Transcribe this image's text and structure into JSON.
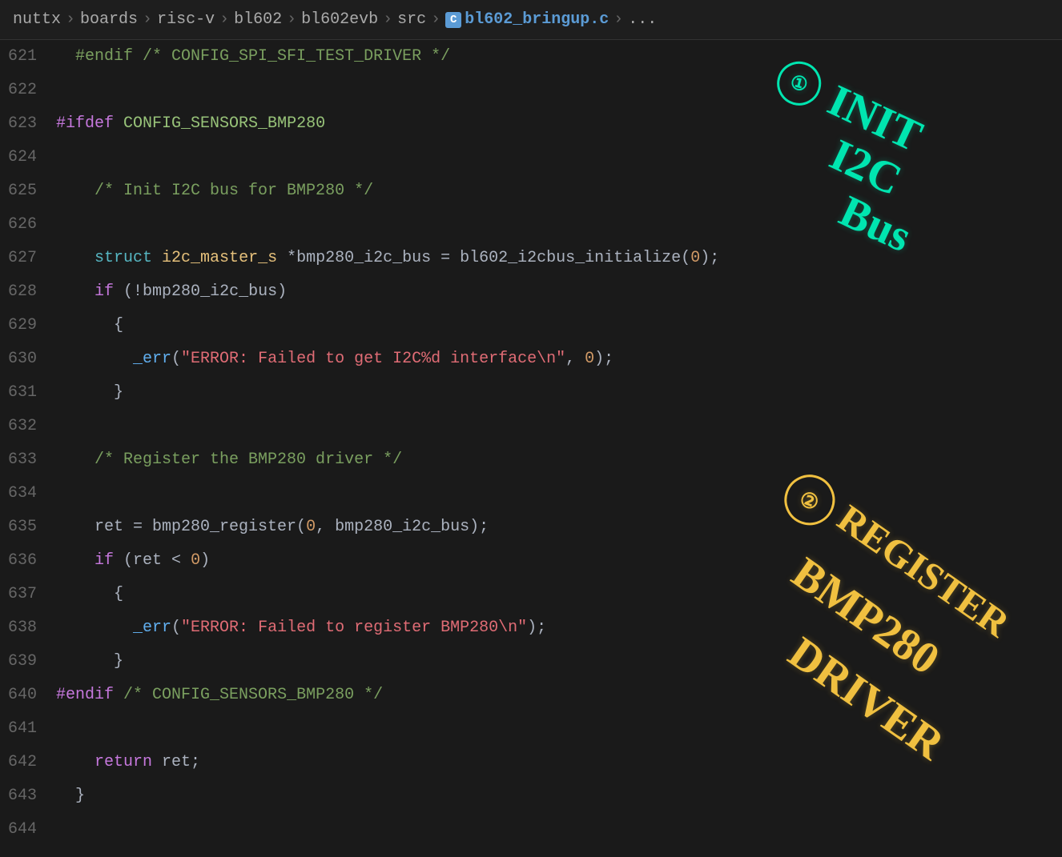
{
  "breadcrumb": {
    "parts": [
      "nuttx",
      "boards",
      "risc-v",
      "bl602",
      "bl602evb",
      "src",
      "bl602_bringup.c",
      "..."
    ],
    "separator": "›",
    "file": "bl602_bringup.c",
    "c_label": "C"
  },
  "lines": [
    {
      "num": "621",
      "content": "  #endif /* CONFIG_SPI_SFI_TEST_DRIVER */",
      "type": "dimmed-comment"
    },
    {
      "num": "622",
      "content": "",
      "type": "empty"
    },
    {
      "num": "623",
      "content": "#ifdef CONFIG_SENSORS_BMP280",
      "type": "ifdef"
    },
    {
      "num": "624",
      "content": "",
      "type": "empty"
    },
    {
      "num": "625",
      "content": "  /* Init I2C bus for BMP280 */",
      "type": "comment"
    },
    {
      "num": "626",
      "content": "",
      "type": "empty"
    },
    {
      "num": "627",
      "content": "  struct i2c_master_s *bmp280_i2c_bus = bl602_i2cbus_initialize(0);",
      "type": "struct-line"
    },
    {
      "num": "628",
      "content": "  if (!bmp280_i2c_bus)",
      "type": "if-line"
    },
    {
      "num": "629",
      "content": "    {",
      "type": "brace"
    },
    {
      "num": "630",
      "content": "      _err(\"ERROR: Failed to get I2C%d interface\\n\", 0);",
      "type": "err-line"
    },
    {
      "num": "631",
      "content": "    }",
      "type": "brace"
    },
    {
      "num": "632",
      "content": "",
      "type": "empty"
    },
    {
      "num": "633",
      "content": "  /* Register the BMP280 driver */",
      "type": "comment"
    },
    {
      "num": "634",
      "content": "",
      "type": "empty"
    },
    {
      "num": "635",
      "content": "  ret = bmp280_register(0, bmp280_i2c_bus);",
      "type": "ret-line"
    },
    {
      "num": "636",
      "content": "  if (ret < 0)",
      "type": "if-line2"
    },
    {
      "num": "637",
      "content": "    {",
      "type": "brace"
    },
    {
      "num": "638",
      "content": "      _err(\"ERROR: Failed to register BMP280\\n\");",
      "type": "err-line2"
    },
    {
      "num": "639",
      "content": "    }",
      "type": "brace"
    },
    {
      "num": "640",
      "content": "#endif /* CONFIG_SENSORS_BMP280 */",
      "type": "endif"
    },
    {
      "num": "641",
      "content": "",
      "type": "empty"
    },
    {
      "num": "642",
      "content": "  return ret;",
      "type": "return-line"
    },
    {
      "num": "643",
      "content": "}",
      "type": "close-brace"
    },
    {
      "num": "644",
      "content": "",
      "type": "empty"
    }
  ],
  "annotation1": {
    "circle": "①",
    "lines": [
      "INIT",
      "I2C",
      "Bus"
    ]
  },
  "annotation2": {
    "circle": "②",
    "lines": [
      "REGISTER",
      "BMP280",
      "DRIVER"
    ]
  }
}
